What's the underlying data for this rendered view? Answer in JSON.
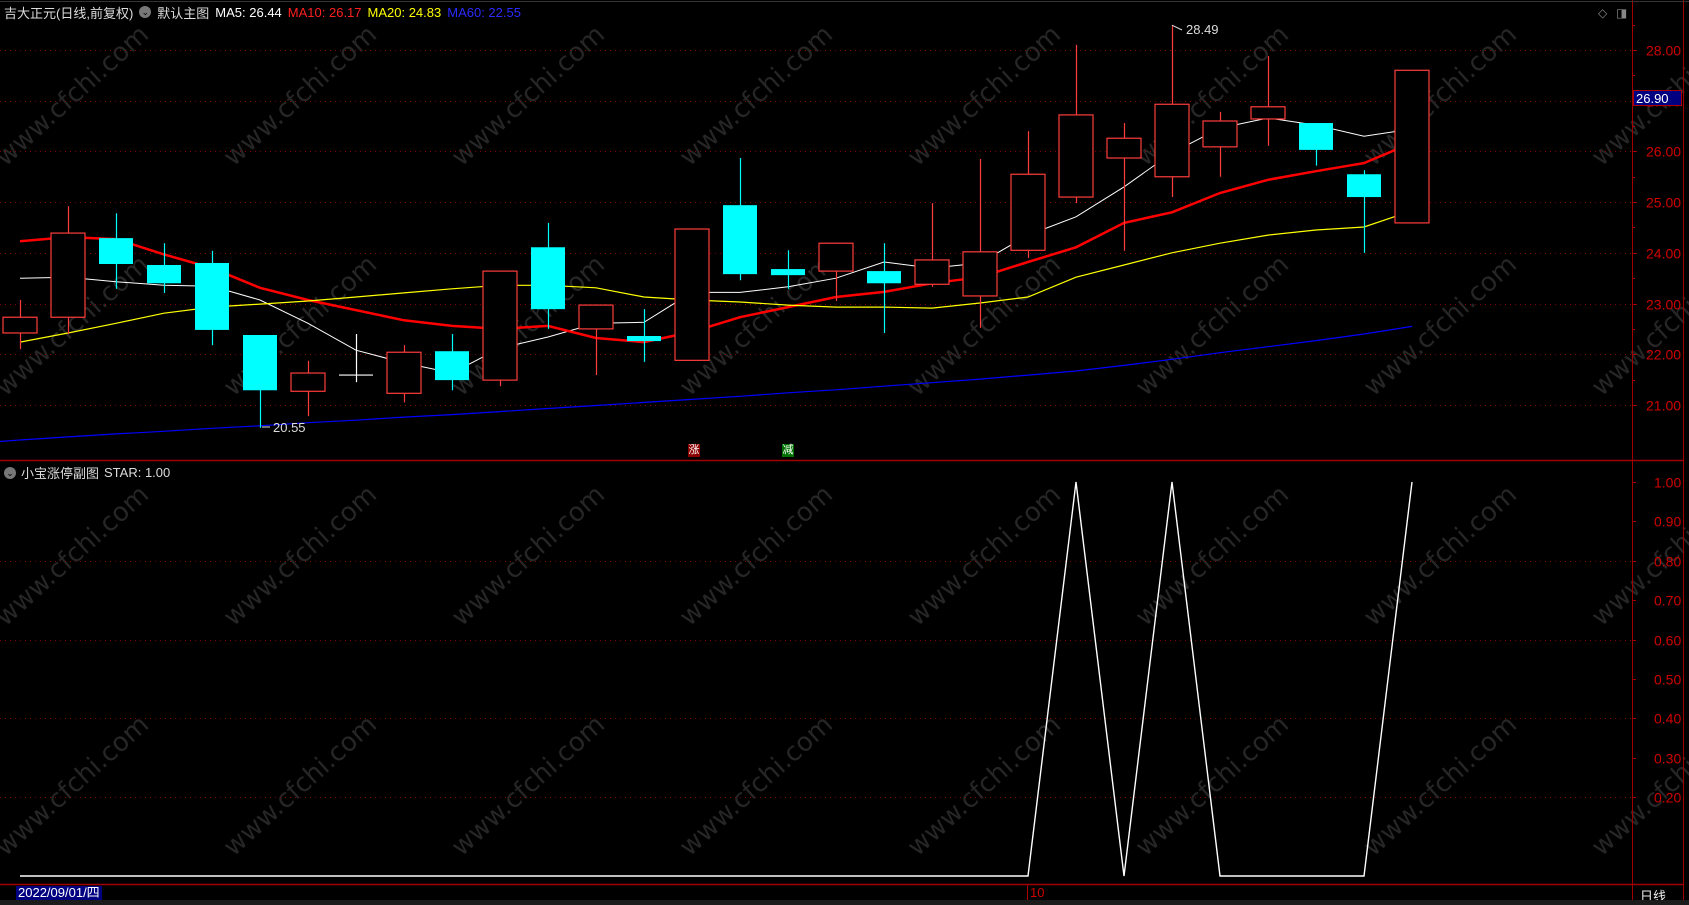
{
  "header": {
    "stock": "吉大正元(日线,前复权)",
    "template": "默认主图",
    "ma5": "MA5: 26.44",
    "ma10": "MA10: 26.17",
    "ma20": "MA20: 24.83",
    "ma60": "MA60: 22.55"
  },
  "sub_header": {
    "title": "小宝涨停副图",
    "star": "STAR: 1.00"
  },
  "colors": {
    "up": "#ff3c3c",
    "down": "#00ffff",
    "ma5": "#ffffff",
    "ma10": "#ff0000",
    "ma20": "#ffff00",
    "ma60": "#0000ff",
    "grid": "#800000",
    "axis": "#a00000"
  },
  "current_price": "26.90",
  "markers": {
    "zhang": "涨",
    "jian": "减"
  },
  "annotations": {
    "high": "28.49",
    "low": "20.55"
  },
  "date_label": "2022/09/01/四",
  "month_tick": "10",
  "period": "日线",
  "watermark": "www.cfchi.com",
  "chart_data": [
    {
      "type": "candlestick",
      "title": "吉大正元(日线,前复权)",
      "ylim": [
        20.2,
        28.9
      ],
      "yticks": [
        "28.00",
        "27.00",
        "26.00",
        "25.00",
        "24.00",
        "23.00",
        "22.00",
        "21.00"
      ],
      "ytick_values": [
        28,
        27,
        26,
        25,
        24,
        23,
        22,
        21
      ],
      "ohlc": [
        [
          22.42,
          23.07,
          22.1,
          22.73
        ],
        [
          22.73,
          24.92,
          22.4,
          24.39
        ],
        [
          24.29,
          24.78,
          23.29,
          23.78
        ],
        [
          23.76,
          24.19,
          23.21,
          23.4
        ],
        [
          23.8,
          24.04,
          22.18,
          22.48
        ],
        [
          22.38,
          22.38,
          20.55,
          21.29
        ],
        [
          21.27,
          21.87,
          20.78,
          21.63
        ],
        [
          21.59,
          22.4,
          21.45,
          21.59
        ],
        [
          21.23,
          22.18,
          21.05,
          22.04
        ],
        [
          22.06,
          22.4,
          21.29,
          21.49
        ],
        [
          21.49,
          23.64,
          21.37,
          23.64
        ],
        [
          24.11,
          24.59,
          22.5,
          22.89
        ],
        [
          22.5,
          22.97,
          21.59,
          22.97
        ],
        [
          22.36,
          22.89,
          21.85,
          22.26
        ],
        [
          21.88,
          24.47,
          21.88,
          24.47
        ],
        [
          24.94,
          25.87,
          23.46,
          23.58
        ],
        [
          23.68,
          24.05,
          23.29,
          23.56
        ],
        [
          23.64,
          24.19,
          23.05,
          24.19
        ],
        [
          23.64,
          24.19,
          22.42,
          23.4
        ],
        [
          23.38,
          24.98,
          23.33,
          23.86
        ],
        [
          23.15,
          25.85,
          22.52,
          24.02
        ],
        [
          24.05,
          26.4,
          23.9,
          25.55
        ],
        [
          25.1,
          28.1,
          24.98,
          26.72
        ],
        [
          25.87,
          26.56,
          24.04,
          26.26
        ],
        [
          25.5,
          28.49,
          25.1,
          26.93
        ],
        [
          26.09,
          26.78,
          25.5,
          26.6
        ],
        [
          26.64,
          27.88,
          26.11,
          26.88
        ],
        [
          26.56,
          26.56,
          25.72,
          26.03
        ],
        [
          25.55,
          25.63,
          24.0,
          25.1
        ],
        [
          24.59,
          27.6,
          24.59,
          27.6
        ]
      ],
      "series": [
        {
          "name": "MA5",
          "values": [
            23.5,
            23.52,
            23.43,
            23.36,
            23.34,
            23.07,
            22.61,
            22.08,
            21.83,
            21.63,
            22.12,
            22.34,
            22.61,
            22.63,
            23.22,
            23.22,
            23.33,
            23.5,
            23.82,
            23.7,
            23.8,
            24.35,
            24.71,
            25.3,
            25.97,
            26.46,
            26.66,
            26.52,
            26.3,
            26.44
          ]
        },
        {
          "name": "MA10",
          "values": [
            24.23,
            24.31,
            24.27,
            23.97,
            23.7,
            23.31,
            23.07,
            22.87,
            22.67,
            22.56,
            22.5,
            22.56,
            22.32,
            22.24,
            22.44,
            22.73,
            22.93,
            23.13,
            23.23,
            23.4,
            23.52,
            23.82,
            24.11,
            24.59,
            24.8,
            25.18,
            25.44,
            25.61,
            25.77,
            26.17
          ]
        },
        {
          "name": "MA20",
          "values": [
            22.24,
            22.42,
            22.61,
            22.81,
            22.93,
            22.99,
            23.05,
            23.13,
            23.21,
            23.29,
            23.36,
            23.36,
            23.31,
            23.13,
            23.07,
            23.03,
            22.97,
            22.93,
            22.93,
            22.91,
            23.01,
            23.13,
            23.52,
            23.76,
            24.0,
            24.19,
            24.35,
            24.45,
            24.51,
            24.83
          ]
        },
        {
          "name": "MA60",
          "values": [
            20.31,
            20.37,
            20.43,
            20.48,
            20.54,
            20.59,
            20.65,
            20.7,
            20.76,
            20.81,
            20.87,
            20.93,
            20.99,
            21.05,
            21.11,
            21.17,
            21.24,
            21.3,
            21.37,
            21.44,
            21.51,
            21.59,
            21.67,
            21.78,
            21.9,
            22.03,
            22.15,
            22.27,
            22.4,
            22.55
          ]
        }
      ]
    },
    {
      "type": "line",
      "title": "小宝涨停副图",
      "ylim": [
        0,
        1
      ],
      "yticks": [
        "1.00",
        "0.90",
        "0.80",
        "0.70",
        "0.60",
        "0.50",
        "0.40",
        "0.30",
        "0.20"
      ],
      "ytick_values": [
        1.0,
        0.9,
        0.8,
        0.7,
        0.6,
        0.5,
        0.4,
        0.3,
        0.2
      ],
      "series": [
        {
          "name": "STAR",
          "values": [
            0,
            0,
            0,
            0,
            0,
            0,
            0,
            0,
            0,
            0,
            0,
            0,
            0,
            0,
            0,
            0,
            0,
            0,
            0,
            0,
            0,
            0,
            1,
            0,
            1,
            0,
            0,
            0,
            0,
            1
          ]
        }
      ]
    }
  ]
}
